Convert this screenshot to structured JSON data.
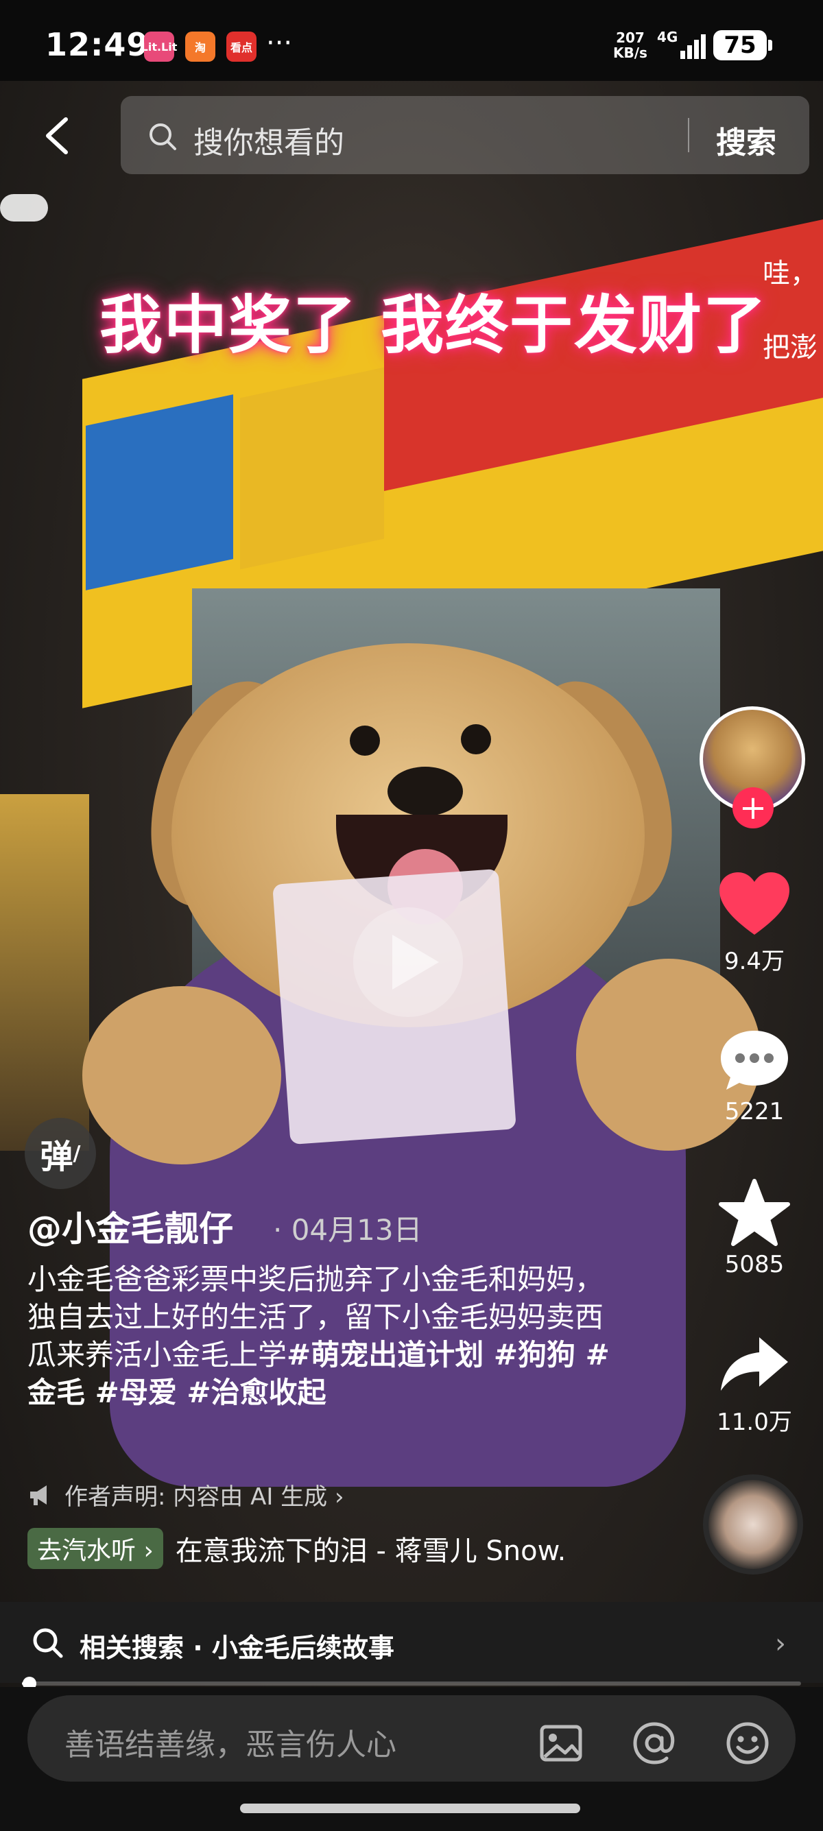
{
  "status_bar": {
    "time": "12:49",
    "apps": [
      {
        "label": "Lit.Lit",
        "color": "#e84a79"
      },
      {
        "label": "淘",
        "color": "#f4782a"
      },
      {
        "label": "看点",
        "color": "#e0302c"
      }
    ],
    "more": "···",
    "net_speed": "207",
    "net_unit": "KB/s",
    "network": "4G",
    "battery": "75"
  },
  "search": {
    "placeholder": "搜你想看的",
    "button": "搜索"
  },
  "video": {
    "overlay_caption": "我中奖了 我终于发财了",
    "side_caption": "哇，\n把澎"
  },
  "author": {
    "name": "@小金毛靓仔",
    "date": "04月13日"
  },
  "description": {
    "text": "小金毛爸爸彩票中奖后抛弃了小金毛和妈妈，独自去过上好的生活了，留下小金毛妈妈卖西瓜来养活小金毛上学",
    "tags": "#萌宠出道计划 #狗狗 #金毛  #母爱 #治愈收起"
  },
  "declaration": "作者声明: 内容由 AI 生成 ›",
  "music": {
    "chip": "去汽水听 ›",
    "title": "在意我流下的泪 - 蒋雪儿 Snow."
  },
  "actions": {
    "likes": "9.4万",
    "comments": "5221",
    "favorites": "5085",
    "shares": "11.0万"
  },
  "danmu_label": "弹",
  "related_search": "相关搜索 · 小金毛后续故事",
  "progress": 0.01,
  "comment": {
    "placeholder": "善语结善缘，恶言伤人心"
  },
  "icons": {
    "back": "chevron-left-icon",
    "search": "search-icon",
    "like": "heart-icon",
    "comment": "comment-bubble-icon",
    "favorite": "star-icon",
    "share": "share-arrow-icon",
    "image": "image-icon",
    "mention": "at-icon",
    "emoji": "emoji-icon"
  },
  "colors": {
    "like": "#ff3b5c",
    "follow": "#ff2d55",
    "music_chip": "#4a6a44",
    "caption_glow": "#ff2e7e"
  }
}
